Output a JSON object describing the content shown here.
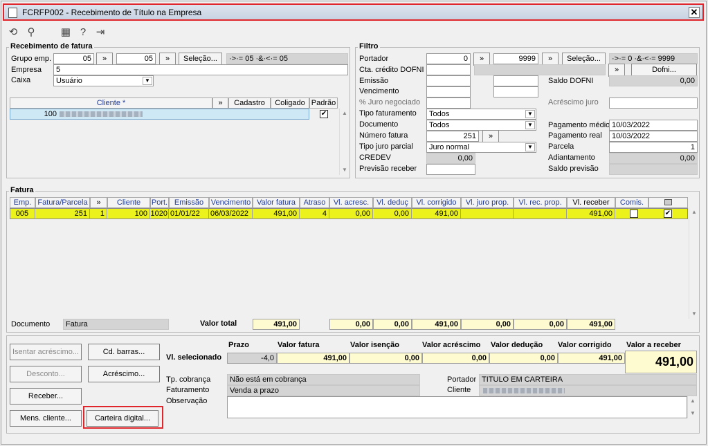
{
  "window": {
    "title": "FCRFP002 - Recebimento de Título na Empresa",
    "close": "✕"
  },
  "toolbar": {
    "icons": [
      "refresh-icon",
      "search-icon",
      "calendar-icon",
      "help-icon",
      "exit-icon"
    ]
  },
  "recebimento": {
    "title": "Recebimento de fatura",
    "grupo_emp_label": "Grupo emp.",
    "grupo_emp_from": "05",
    "grupo_emp_to": "05",
    "arrows": "»",
    "selecao_label": "Seleção...",
    "grupo_summary": "·>·= 05 ·&·<·= 05",
    "empresa_label": "Empresa",
    "empresa_value": "5",
    "caixa_label": "Caixa",
    "caixa_value": "Usuário",
    "cols": {
      "cliente": "Cliente *",
      "arrow": "»",
      "cadastro": "Cadastro",
      "coligado": "Coligado",
      "padrao": "Padrão"
    },
    "row": {
      "cliente_code": "100",
      "padrao_checked": "✔"
    }
  },
  "filtro": {
    "title": "Filtro",
    "portador_label": "Portador",
    "portador_from": "0",
    "portador_to": "9999",
    "portador_summary": "·>·= 0 ·&·<·= 9999",
    "selecao_label": "Seleção...",
    "cta_label": "Cta. crédito DOFNI",
    "dofni_label": "Dofni...",
    "emissao_label": "Emissão",
    "saldo_dofni_label": "Saldo DOFNI",
    "saldo_dofni_value": "0,00",
    "vencimento_label": "Vencimento",
    "juro_neg_label": "% Juro negociado",
    "acrescimo_juro_label": "Acréscimo juro",
    "tipo_fat_label": "Tipo faturamento",
    "tipo_fat_value": "Todos",
    "pagamento_medio_label": "Pagamento médio",
    "pagamento_medio_value": "10/03/2022",
    "documento_label": "Documento",
    "documento_value": "Todos",
    "pagamento_real_label": "Pagamento real",
    "pagamento_real_value": "10/03/2022",
    "numero_fatura_label": "Número fatura",
    "numero_fatura_value": "251",
    "parcela_label": "Parcela",
    "parcela_value": "1",
    "tipo_juro_label": "Tipo juro parcial",
    "tipo_juro_value": "Juro normal",
    "adiantamento_label": "Adiantamento",
    "adiantamento_value": "0,00",
    "credev_label": "CREDEV",
    "credev_value": "0,00",
    "previsao_label": "Previsão receber",
    "saldo_previsao_label": "Saldo previsão"
  },
  "fatura": {
    "title": "Fatura",
    "headers": [
      "Emp.",
      "Fatura/Parcela",
      "»",
      "Cliente",
      "Port.",
      "Emissão",
      "Vencimento",
      "Valor fatura",
      "Atraso",
      "Vl. acresc.",
      "Vl. deduç",
      "Vl. corrigido",
      "Vl. juro prop.",
      "Vl. rec. prop.",
      "Vl. receber",
      "Comis.",
      ""
    ],
    "row": {
      "emp": "005",
      "fatura": "251",
      "parcela": "1",
      "cliente": "100",
      "port": "1020",
      "emissao": "01/01/22",
      "vencimento": "06/03/2022",
      "valor_fatura": "491,00",
      "atraso": "4",
      "acresc": "0,00",
      "deduc": "0,00",
      "corrigido": "491,00",
      "juro_prop": "",
      "rec_prop": "",
      "receber": "491,00",
      "sel": "✔"
    },
    "documento_label": "Documento",
    "documento_value": "Fatura",
    "valor_total_label": "Valor total",
    "totals": {
      "valor_fatura": "491,00",
      "acresc": "0,00",
      "deduc": "0,00",
      "corrigido": "491,00",
      "juro_prop": "0,00",
      "rec_prop": "0,00",
      "receber": "491,00"
    }
  },
  "bottom": {
    "buttons": {
      "isentar": "Isentar acréscimo...",
      "cd_barras": "Cd. barras...",
      "desconto": "Desconto...",
      "acrescimo": "Acréscimo...",
      "receber": "Receber...",
      "mens_cliente": "Mens. cliente...",
      "carteira": "Carteira digital..."
    },
    "headers": {
      "prazo": "Prazo",
      "valor_fatura": "Valor fatura",
      "valor_isencao": "Valor isenção",
      "valor_acrescimo": "Valor acréscimo",
      "valor_deducao": "Valor dedução",
      "valor_corrigido": "Valor corrigido",
      "valor_receber": "Valor a receber"
    },
    "vl_selecionado_label": "Vl. selecionado",
    "values": {
      "prazo": "-4,0",
      "valor_fatura": "491,00",
      "valor_isencao": "0,00",
      "valor_acrescimo": "0,00",
      "valor_deducao": "0,00",
      "valor_corrigido": "491,00",
      "valor_receber": "491,00"
    },
    "tp_cobranca_label": "Tp. cobrança",
    "tp_cobranca_value": "Não está em cobrança",
    "faturamento_label": "Faturamento",
    "faturamento_value": "Venda a prazo",
    "observacao_label": "Observação",
    "portador_label": "Portador",
    "portador_value": "TITULO EM CARTEIRA",
    "cliente_label": "Cliente"
  }
}
